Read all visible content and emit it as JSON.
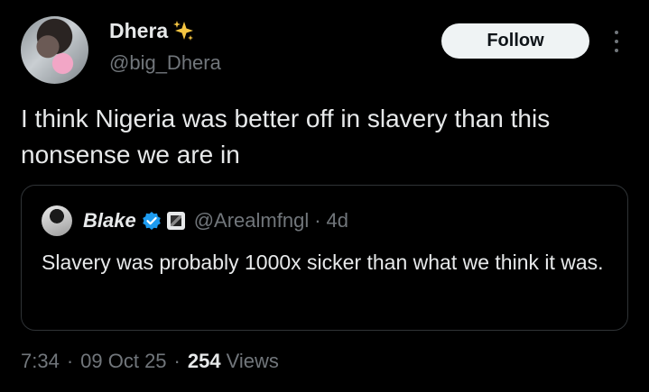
{
  "author": {
    "display_name": "Dhera",
    "name_emoji_icon": "sparkles-icon",
    "handle": "@big_Dhera"
  },
  "follow_label": "Follow",
  "more_icon": "more-vertical-icon",
  "tweet_text": "I think Nigeria was better off in slavery than this nonsense we are in",
  "quote": {
    "display_name": "Blake",
    "verified_icon": "verified-badge-icon",
    "affiliate_icon": "affiliate-badge-icon",
    "handle": "@Arealmfngl",
    "separator": "·",
    "time": "4d",
    "text": "Slavery was probably 1000x sicker than what we think it was."
  },
  "meta": {
    "time": "7:34",
    "separator": "·",
    "date": "09 Oct 25",
    "views_count": "254",
    "views_label": "Views"
  },
  "colors": {
    "background": "#000000",
    "text": "#e7e9ea",
    "secondary": "#71767b",
    "border": "#2f3336",
    "verified": "#1d9bf0",
    "follow_bg": "#eff3f4"
  }
}
